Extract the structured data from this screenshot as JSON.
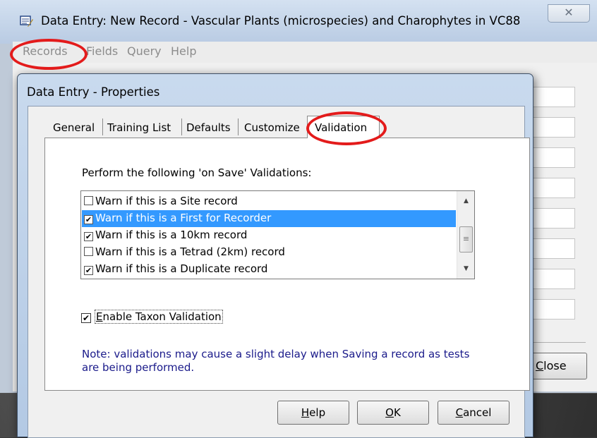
{
  "main_window": {
    "title": "Data Entry: New Record - Vascular Plants (microspecies) and Charophytes in VC88",
    "close_glyph": "✕",
    "menu": [
      "Records",
      "Fields",
      "Query",
      "Help"
    ],
    "close_button": {
      "prefix": "",
      "underlined": "C",
      "rest": "lose"
    }
  },
  "dialog": {
    "title": "Data Entry - Properties",
    "tabs": [
      "General",
      "Training List",
      "Defaults",
      "Customize",
      "Validation"
    ],
    "active_tab": "Validation",
    "prompt": "Perform the following 'on Save' Validations:",
    "validations": [
      {
        "label": "Warn if this is a Site record",
        "checked": false,
        "selected": false
      },
      {
        "label": "Warn if this is a First for Recorder",
        "checked": true,
        "selected": true
      },
      {
        "label": "Warn if this is a 10km record",
        "checked": true,
        "selected": false
      },
      {
        "label": "Warn if this is a Tetrad (2km) record",
        "checked": false,
        "selected": false
      },
      {
        "label": "Warn if this is a Duplicate record",
        "checked": true,
        "selected": false
      }
    ],
    "taxon_validation": {
      "label": "Enable Taxon Validation",
      "checked": true,
      "underlined": "E",
      "rest": "nable Taxon Validation"
    },
    "note": "Note: validations may cause a slight delay when Saving a record as tests are being performed.",
    "buttons": [
      {
        "underlined": "H",
        "rest": "elp"
      },
      {
        "underlined": "O",
        "rest": "K"
      },
      {
        "underlined": "C",
        "rest": "ancel"
      }
    ]
  },
  "icons": {
    "checkmark": "✔",
    "scroll_up": "▲",
    "scroll_down": "▼",
    "scroll_grip": "≡"
  },
  "colors": {
    "selection": "#3399ff",
    "note_text": "#1a1a8a",
    "highlight_circle": "#e31b1b"
  }
}
